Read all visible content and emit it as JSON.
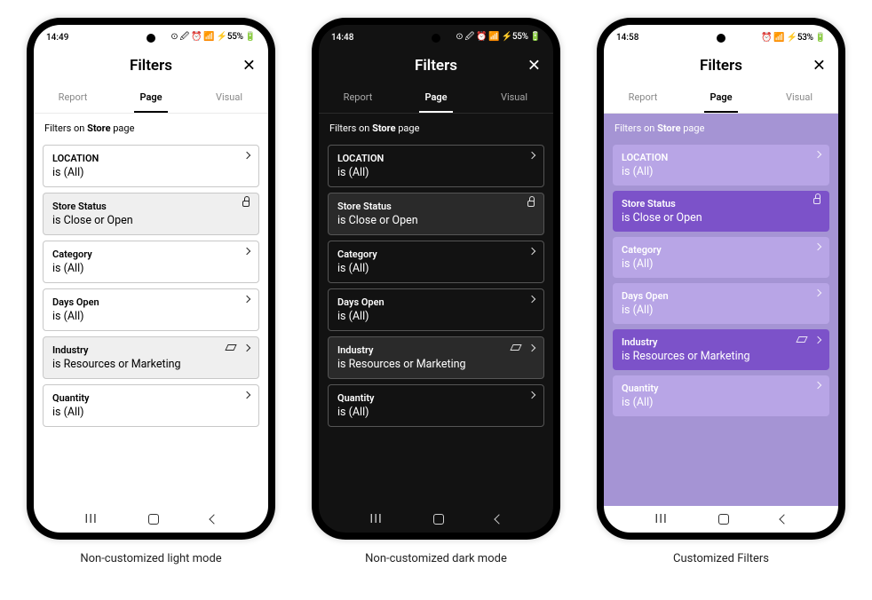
{
  "phones": [
    {
      "theme": "light",
      "status": {
        "time": "14:49",
        "right": "⊙ 🖉 ⏰ 📶 ⚡55% 🔋"
      },
      "header": {
        "title": "Filters",
        "close": "✕"
      },
      "tabs": [
        {
          "label": "Report",
          "active": false
        },
        {
          "label": "Page",
          "active": true
        },
        {
          "label": "Visual",
          "active": false
        }
      ],
      "pageLabelPre": "Filters on ",
      "pageLabelBold": "Store",
      "pageLabelPost": " page",
      "filters": [
        {
          "title": "LOCATION",
          "value": "is (All)",
          "applied": false,
          "icons": [
            "chevron"
          ]
        },
        {
          "title": "Store Status",
          "value": "is Close or Open",
          "applied": true,
          "icons": [
            "lock"
          ]
        },
        {
          "title": "Category",
          "value": "is (All)",
          "applied": false,
          "icons": [
            "chevron"
          ]
        },
        {
          "title": "Days Open",
          "value": "is (All)",
          "applied": false,
          "icons": [
            "chevron"
          ]
        },
        {
          "title": "Industry",
          "value": "is Resources or Marketing",
          "applied": true,
          "icons": [
            "eraser",
            "chevron"
          ]
        },
        {
          "title": "Quantity",
          "value": "is (All)",
          "applied": false,
          "icons": [
            "chevron"
          ]
        }
      ],
      "caption": "Non-customized light mode"
    },
    {
      "theme": "dark",
      "status": {
        "time": "14:48",
        "right": "⊙ 🖉 ⏰ 📶 ⚡55% 🔋"
      },
      "header": {
        "title": "Filters",
        "close": "✕"
      },
      "tabs": [
        {
          "label": "Report",
          "active": false
        },
        {
          "label": "Page",
          "active": true
        },
        {
          "label": "Visual",
          "active": false
        }
      ],
      "pageLabelPre": "Filters on ",
      "pageLabelBold": "Store",
      "pageLabelPost": " page",
      "filters": [
        {
          "title": "LOCATION",
          "value": "is (All)",
          "applied": false,
          "icons": [
            "chevron"
          ]
        },
        {
          "title": "Store Status",
          "value": "is Close or Open",
          "applied": true,
          "icons": [
            "lock"
          ]
        },
        {
          "title": "Category",
          "value": "is (All)",
          "applied": false,
          "icons": [
            "chevron"
          ]
        },
        {
          "title": "Days Open",
          "value": "is (All)",
          "applied": false,
          "icons": [
            "chevron"
          ]
        },
        {
          "title": "Industry",
          "value": "is Resources or Marketing",
          "applied": true,
          "icons": [
            "eraser",
            "chevron"
          ]
        },
        {
          "title": "Quantity",
          "value": "is (All)",
          "applied": false,
          "icons": [
            "chevron"
          ]
        }
      ],
      "caption": "Non-customized dark mode"
    },
    {
      "theme": "custom",
      "status": {
        "time": "14:58",
        "right": "⏰ 📶 ⚡53% 🔋"
      },
      "header": {
        "title": "Filters",
        "close": "✕"
      },
      "tabs": [
        {
          "label": "Report",
          "active": false
        },
        {
          "label": "Page",
          "active": true
        },
        {
          "label": "Visual",
          "active": false
        }
      ],
      "pageLabelPre": "Filters on ",
      "pageLabelBold": "Store",
      "pageLabelPost": " page",
      "filters": [
        {
          "title": "LOCATION",
          "value": "is (All)",
          "applied": false,
          "icons": [
            "chevron"
          ]
        },
        {
          "title": "Store Status",
          "value": "is Close or Open",
          "applied": true,
          "icons": [
            "lock"
          ]
        },
        {
          "title": "Category",
          "value": "is (All)",
          "applied": false,
          "icons": [
            "chevron"
          ]
        },
        {
          "title": "Days Open",
          "value": "is (All)",
          "applied": false,
          "icons": [
            "chevron"
          ]
        },
        {
          "title": "Industry",
          "value": "is Resources or Marketing",
          "applied": true,
          "icons": [
            "eraser",
            "chevron"
          ]
        },
        {
          "title": "Quantity",
          "value": "is (All)",
          "applied": false,
          "icons": [
            "chevron"
          ]
        }
      ],
      "caption": "Customized Filters"
    }
  ]
}
